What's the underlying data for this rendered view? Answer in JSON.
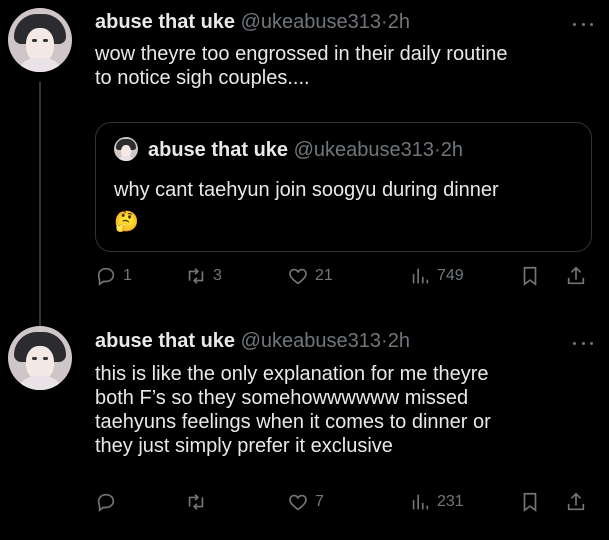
{
  "tweets": [
    {
      "author": {
        "display_name": "abuse that uke",
        "handle": "@ukeabuse313",
        "separator": "·",
        "time": "2h",
        "avatar_icon": "user-avatar"
      },
      "text_lines": [
        "wow theyre too engrossed in their daily routine",
        "to notice sigh couples...."
      ],
      "quote": {
        "display_name": "abuse that uke",
        "handle": "@ukeabuse313",
        "separator": "·",
        "time": "2h",
        "text": "why cant taehyun join soogyu during dinner",
        "emoji": "🤔"
      },
      "stats": {
        "replies": "1",
        "retweets": "3",
        "likes": "21",
        "views": "749"
      }
    },
    {
      "author": {
        "display_name": "abuse that uke",
        "handle": "@ukeabuse313",
        "separator": "·",
        "time": "2h",
        "avatar_icon": "user-avatar"
      },
      "text_lines": [
        "this is like the only explanation for me theyre",
        "both F’s so they somehowwwwww missed",
        "taehyuns feelings when it comes to dinner or",
        "they just simply prefer it exclusive"
      ],
      "stats": {
        "replies": "",
        "retweets": "",
        "likes": "7",
        "views": "231"
      }
    }
  ],
  "colors": {
    "background": "#000000",
    "text": "#e7e9ea",
    "muted": "#71767b",
    "border": "#2f3336"
  },
  "icons": [
    "reply-icon",
    "retweet-icon",
    "like-icon",
    "views-icon",
    "bookmark-icon",
    "share-icon",
    "more-icon"
  ]
}
